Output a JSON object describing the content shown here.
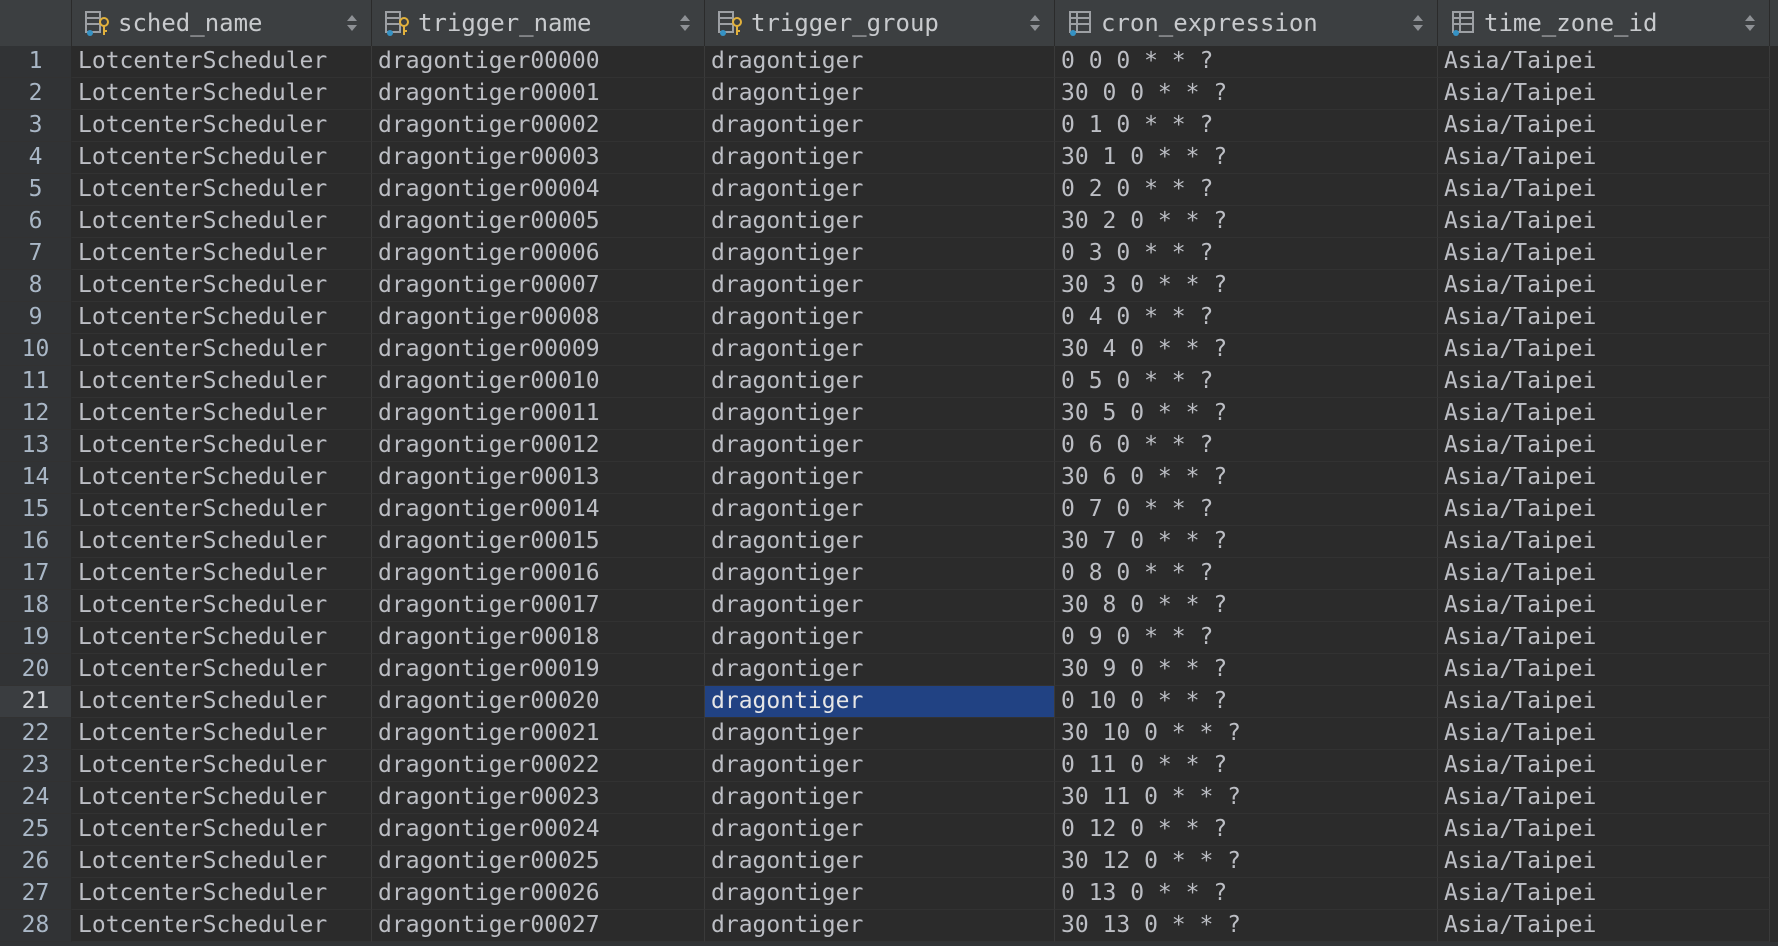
{
  "columns": [
    {
      "label": "sched_name",
      "icon": "primary-key-column-icon"
    },
    {
      "label": "trigger_name",
      "icon": "primary-key-column-icon"
    },
    {
      "label": "trigger_group",
      "icon": "primary-key-column-icon"
    },
    {
      "label": "cron_expression",
      "icon": "column-icon"
    },
    {
      "label": "time_zone_id",
      "icon": "column-icon"
    }
  ],
  "selected_cell": {
    "row": 21,
    "column": "trigger_group"
  },
  "colors": {
    "background": "#2b2b2b",
    "header": "#3c3f41",
    "selection": "#214283",
    "text": "#bcbec4"
  },
  "rows": [
    [
      "1",
      "LotcenterScheduler",
      "dragontiger00000",
      "dragontiger",
      "0 0 0 * * ?",
      "Asia/Taipei"
    ],
    [
      "2",
      "LotcenterScheduler",
      "dragontiger00001",
      "dragontiger",
      "30 0 0 * * ?",
      "Asia/Taipei"
    ],
    [
      "3",
      "LotcenterScheduler",
      "dragontiger00002",
      "dragontiger",
      "0 1 0 * * ?",
      "Asia/Taipei"
    ],
    [
      "4",
      "LotcenterScheduler",
      "dragontiger00003",
      "dragontiger",
      "30 1 0 * * ?",
      "Asia/Taipei"
    ],
    [
      "5",
      "LotcenterScheduler",
      "dragontiger00004",
      "dragontiger",
      "0 2 0 * * ?",
      "Asia/Taipei"
    ],
    [
      "6",
      "LotcenterScheduler",
      "dragontiger00005",
      "dragontiger",
      "30 2 0 * * ?",
      "Asia/Taipei"
    ],
    [
      "7",
      "LotcenterScheduler",
      "dragontiger00006",
      "dragontiger",
      "0 3 0 * * ?",
      "Asia/Taipei"
    ],
    [
      "8",
      "LotcenterScheduler",
      "dragontiger00007",
      "dragontiger",
      "30 3 0 * * ?",
      "Asia/Taipei"
    ],
    [
      "9",
      "LotcenterScheduler",
      "dragontiger00008",
      "dragontiger",
      "0 4 0 * * ?",
      "Asia/Taipei"
    ],
    [
      "10",
      "LotcenterScheduler",
      "dragontiger00009",
      "dragontiger",
      "30 4 0 * * ?",
      "Asia/Taipei"
    ],
    [
      "11",
      "LotcenterScheduler",
      "dragontiger00010",
      "dragontiger",
      "0 5 0 * * ?",
      "Asia/Taipei"
    ],
    [
      "12",
      "LotcenterScheduler",
      "dragontiger00011",
      "dragontiger",
      "30 5 0 * * ?",
      "Asia/Taipei"
    ],
    [
      "13",
      "LotcenterScheduler",
      "dragontiger00012",
      "dragontiger",
      "0 6 0 * * ?",
      "Asia/Taipei"
    ],
    [
      "14",
      "LotcenterScheduler",
      "dragontiger00013",
      "dragontiger",
      "30 6 0 * * ?",
      "Asia/Taipei"
    ],
    [
      "15",
      "LotcenterScheduler",
      "dragontiger00014",
      "dragontiger",
      "0 7 0 * * ?",
      "Asia/Taipei"
    ],
    [
      "16",
      "LotcenterScheduler",
      "dragontiger00015",
      "dragontiger",
      "30 7 0 * * ?",
      "Asia/Taipei"
    ],
    [
      "17",
      "LotcenterScheduler",
      "dragontiger00016",
      "dragontiger",
      "0 8 0 * * ?",
      "Asia/Taipei"
    ],
    [
      "18",
      "LotcenterScheduler",
      "dragontiger00017",
      "dragontiger",
      "30 8 0 * * ?",
      "Asia/Taipei"
    ],
    [
      "19",
      "LotcenterScheduler",
      "dragontiger00018",
      "dragontiger",
      "0 9 0 * * ?",
      "Asia/Taipei"
    ],
    [
      "20",
      "LotcenterScheduler",
      "dragontiger00019",
      "dragontiger",
      "30 9 0 * * ?",
      "Asia/Taipei"
    ],
    [
      "21",
      "LotcenterScheduler",
      "dragontiger00020",
      "dragontiger",
      "0 10 0 * * ?",
      "Asia/Taipei"
    ],
    [
      "22",
      "LotcenterScheduler",
      "dragontiger00021",
      "dragontiger",
      "30 10 0 * * ?",
      "Asia/Taipei"
    ],
    [
      "23",
      "LotcenterScheduler",
      "dragontiger00022",
      "dragontiger",
      "0 11 0 * * ?",
      "Asia/Taipei"
    ],
    [
      "24",
      "LotcenterScheduler",
      "dragontiger00023",
      "dragontiger",
      "30 11 0 * * ?",
      "Asia/Taipei"
    ],
    [
      "25",
      "LotcenterScheduler",
      "dragontiger00024",
      "dragontiger",
      "0 12 0 * * ?",
      "Asia/Taipei"
    ],
    [
      "26",
      "LotcenterScheduler",
      "dragontiger00025",
      "dragontiger",
      "30 12 0 * * ?",
      "Asia/Taipei"
    ],
    [
      "27",
      "LotcenterScheduler",
      "dragontiger00026",
      "dragontiger",
      "0 13 0 * * ?",
      "Asia/Taipei"
    ],
    [
      "28",
      "LotcenterScheduler",
      "dragontiger00027",
      "dragontiger",
      "30 13 0 * * ?",
      "Asia/Taipei"
    ]
  ]
}
